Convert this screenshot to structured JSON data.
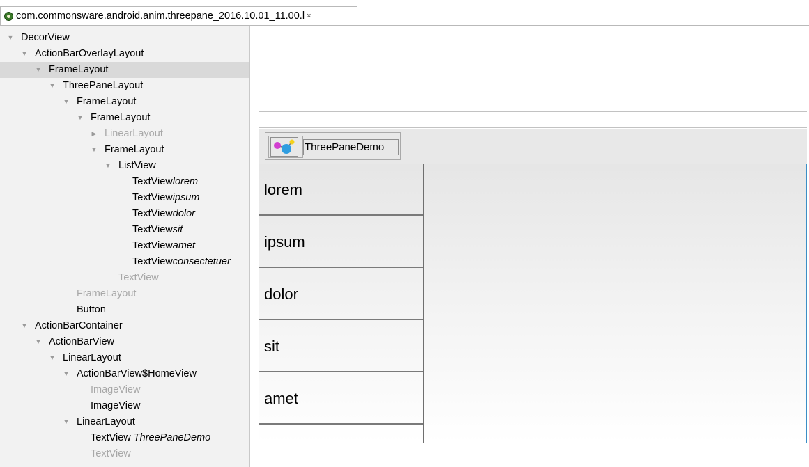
{
  "tab": {
    "title": "com.commonsware.android.anim.threepane_2016.10.01_11.00.l",
    "close": "×"
  },
  "tree": {
    "rows": [
      {
        "label": "DecorView",
        "italic": "",
        "dim": false
      },
      {
        "label": "ActionBarOverlayLayout",
        "italic": "",
        "dim": false
      },
      {
        "label": "FrameLayout",
        "italic": "",
        "dim": false
      },
      {
        "label": "ThreePaneLayout",
        "italic": "",
        "dim": false
      },
      {
        "label": "FrameLayout",
        "italic": "",
        "dim": false
      },
      {
        "label": "FrameLayout",
        "italic": "",
        "dim": false
      },
      {
        "label": "LinearLayout",
        "italic": "",
        "dim": true
      },
      {
        "label": "FrameLayout",
        "italic": "",
        "dim": false
      },
      {
        "label": "ListView",
        "italic": "",
        "dim": false
      },
      {
        "label": "TextView",
        "italic": "lorem",
        "dim": false
      },
      {
        "label": "TextView",
        "italic": "ipsum",
        "dim": false
      },
      {
        "label": "TextView",
        "italic": "dolor",
        "dim": false
      },
      {
        "label": "TextView",
        "italic": "sit",
        "dim": false
      },
      {
        "label": "TextView",
        "italic": "amet",
        "dim": false
      },
      {
        "label": "TextView",
        "italic": "consectetuer",
        "dim": false
      },
      {
        "label": "TextView",
        "italic": "",
        "dim": true
      },
      {
        "label": "FrameLayout",
        "italic": "",
        "dim": true
      },
      {
        "label": "Button",
        "italic": "",
        "dim": false
      },
      {
        "label": "ActionBarContainer",
        "italic": "",
        "dim": false
      },
      {
        "label": "ActionBarView",
        "italic": "",
        "dim": false
      },
      {
        "label": "LinearLayout",
        "italic": "",
        "dim": false
      },
      {
        "label": "ActionBarView$HomeView",
        "italic": "",
        "dim": false
      },
      {
        "label": "ImageView",
        "italic": "",
        "dim": true
      },
      {
        "label": "ImageView",
        "italic": "",
        "dim": false
      },
      {
        "label": "LinearLayout",
        "italic": "",
        "dim": false
      },
      {
        "label": "TextView",
        "italic": "ThreePaneDemo",
        "dim": false
      },
      {
        "label": "TextView",
        "italic": "",
        "dim": true
      }
    ]
  },
  "preview": {
    "app_title": "ThreePaneDemo",
    "app_icon": "app-launcher-icon",
    "list_items": [
      "lorem",
      "ipsum",
      "dolor",
      "sit",
      "amet"
    ]
  },
  "colors": {
    "selection": "#d9d9d9",
    "focus_border": "#3c8ec6",
    "dim_text": "#a8a8a8"
  }
}
